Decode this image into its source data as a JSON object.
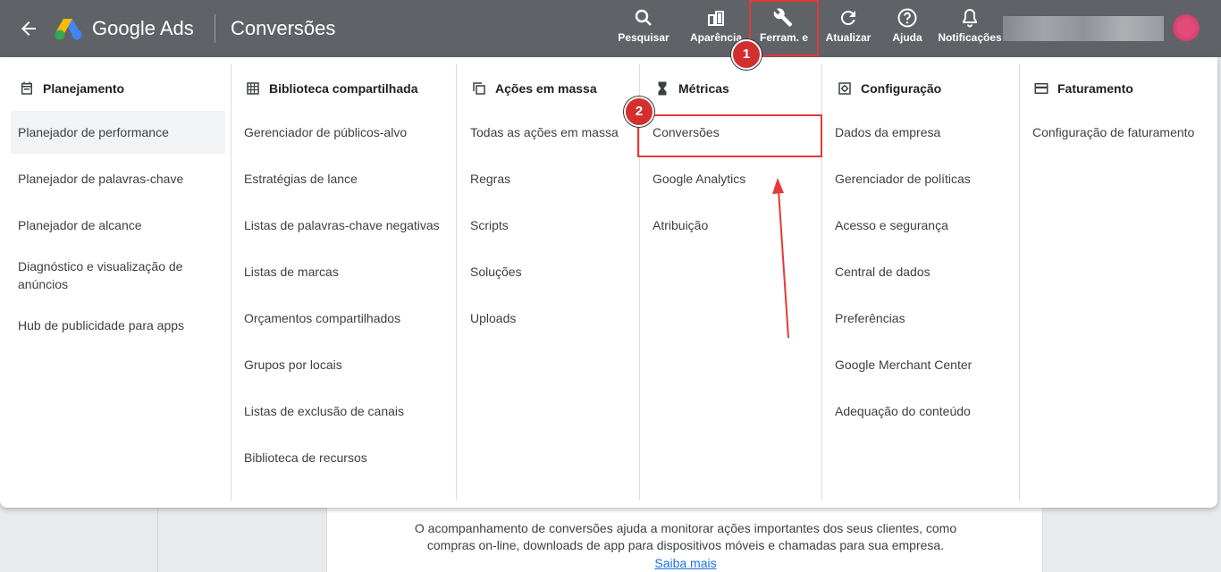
{
  "header": {
    "brand": "Google Ads",
    "title": "Conversões",
    "actions": [
      {
        "label": "Pesquisar",
        "icon": "search-icon"
      },
      {
        "label": "Aparência",
        "icon": "appearance-icon"
      },
      {
        "label": "Ferram. e",
        "icon": "wrench-icon"
      },
      {
        "label": "Atualizar",
        "icon": "refresh-icon"
      },
      {
        "label": "Ajuda",
        "icon": "help-icon"
      },
      {
        "label": "Notificações",
        "icon": "bell-icon"
      }
    ]
  },
  "annotations": {
    "step1": "1",
    "step2": "2",
    "highlight_color": "#e53935"
  },
  "menu": {
    "columns": [
      {
        "title": "Planejamento",
        "icon": "calendar-icon",
        "items": [
          "Planejador de performance",
          "Planejador de palavras-chave",
          "Planejador de alcance",
          "Diagnóstico e visualização de anúncios",
          "Hub de publicidade para apps"
        ]
      },
      {
        "title": "Biblioteca compartilhada",
        "icon": "library-grid-icon",
        "items": [
          "Gerenciador de públicos-alvo",
          "Estratégias de lance",
          "Listas de palavras-chave negativas",
          "Listas de marcas",
          "Orçamentos compartilhados",
          "Grupos por locais",
          "Listas de exclusão de canais",
          "Biblioteca de recursos"
        ]
      },
      {
        "title": "Ações em massa",
        "icon": "copy-icon",
        "items": [
          "Todas as ações em massa",
          "Regras",
          "Scripts",
          "Soluções",
          "Uploads"
        ]
      },
      {
        "title": "Métricas",
        "icon": "hourglass-icon",
        "items": [
          "Conversões",
          "Google Analytics",
          "Atribuição"
        ]
      },
      {
        "title": "Configuração",
        "icon": "settings-icon",
        "items": [
          "Dados da empresa",
          "Gerenciador de políticas",
          "Acesso e segurança",
          "Central de dados",
          "Preferências",
          "Google Merchant Center",
          "Adequação do conteúdo"
        ]
      },
      {
        "title": "Faturamento",
        "icon": "credit-card-icon",
        "items": [
          "Configuração de faturamento"
        ]
      }
    ]
  },
  "page": {
    "description_line1": "O acompanhamento de conversões ajuda a monitorar ações importantes dos seus clientes, como",
    "description_line2": "compras on-line, downloads de app para dispositivos móveis e chamadas para sua empresa.",
    "learn_more": "Saiba mais"
  }
}
